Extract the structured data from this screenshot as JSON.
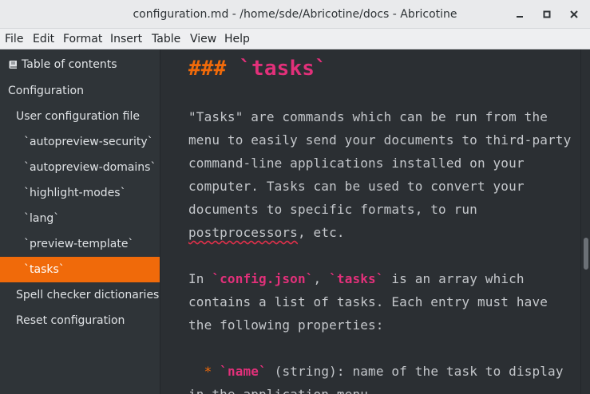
{
  "window": {
    "title": "configuration.md - /home/sde/Abricotine/docs - Abricotine"
  },
  "menubar": [
    "File",
    "Edit",
    "Format",
    "Insert",
    "Table",
    "View",
    "Help"
  ],
  "sidebar": {
    "header": "Table of contents",
    "header_icon": "book-icon",
    "items": [
      {
        "label": "Configuration",
        "level": 1
      },
      {
        "label": "User configuration file",
        "level": 2
      },
      {
        "label": "`autopreview-security`",
        "level": 3
      },
      {
        "label": "`autopreview-domains`",
        "level": 3
      },
      {
        "label": "`highlight-modes`",
        "level": 3
      },
      {
        "label": "`lang`",
        "level": 3
      },
      {
        "label": "`preview-template`",
        "level": 3
      },
      {
        "label": "`tasks`",
        "level": 3,
        "active": true
      },
      {
        "label": "Spell checker dictionaries",
        "level": 2
      },
      {
        "label": "Reset configuration",
        "level": 2
      }
    ]
  },
  "editor": {
    "heading_hash": "###",
    "heading_code": "`tasks`",
    "para1": [
      "\"Tasks\" are commands which can be run from the",
      "menu to easily send your documents to third-party",
      "command-line applications installed on your",
      "computer. Tasks can be used to convert your",
      "documents to specific formats, to run"
    ],
    "para1_misspelled": "postprocessors",
    "para1_last_rest": ", etc.",
    "para2_l1_a": "In ",
    "para2_l1_code1": "`config.json`",
    "para2_l1_b": ", ",
    "para2_l1_code2": "`tasks`",
    "para2_l1_c": " is an array which",
    "para2_l2": "contains a list of tasks. Each entry must have",
    "para2_l3": "the following properties:",
    "list_l1_bullet": "*",
    "list_l1_code": "`name`",
    "list_l1_rest": " (string): name of the task to display",
    "list_l2": "in the application menu"
  },
  "colors": {
    "accent": "#f06a0a",
    "code": "#e2307a",
    "background": "#2b2f33"
  }
}
